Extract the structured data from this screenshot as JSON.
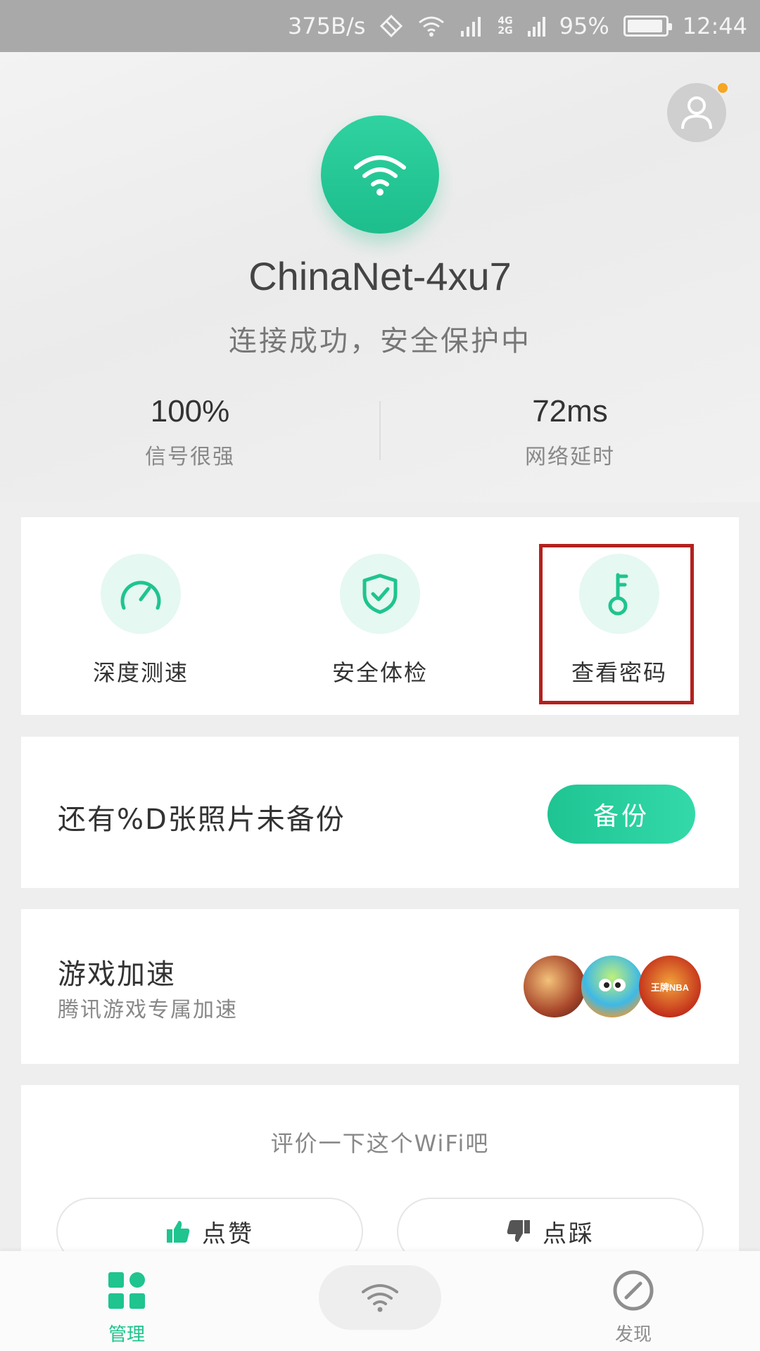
{
  "status_bar": {
    "speed": "375B/s",
    "net_top": "4G",
    "net_bottom": "2G",
    "battery": "95%",
    "time": "12:44"
  },
  "wifi": {
    "ssid": "ChinaNet-4xu7",
    "status": "连接成功，安全保护中"
  },
  "stats": [
    {
      "value": "100%",
      "label": "信号很强"
    },
    {
      "value": "72ms",
      "label": "网络延时"
    }
  ],
  "tools": [
    {
      "label": "深度测速",
      "icon": "speedometer-icon"
    },
    {
      "label": "安全体检",
      "icon": "shield-check-icon"
    },
    {
      "label": "查看密码",
      "icon": "key-icon"
    }
  ],
  "backup": {
    "text": "还有%D张照片未备份",
    "button": "备份"
  },
  "game": {
    "title": "游戏加速",
    "subtitle": "腾讯游戏专属加速",
    "icons": [
      "game-icon-honor-of-kings",
      "game-icon-fish",
      "game-icon-nba"
    ],
    "nba_label": "王牌NBA"
  },
  "rate": {
    "prompt": "评价一下这个WiFi吧",
    "like": "点赞",
    "dislike": "点踩"
  },
  "nav": {
    "manage": "管理",
    "discover": "发现"
  },
  "colors": {
    "accent": "#1fc48f",
    "highlight": "#b2221f"
  }
}
